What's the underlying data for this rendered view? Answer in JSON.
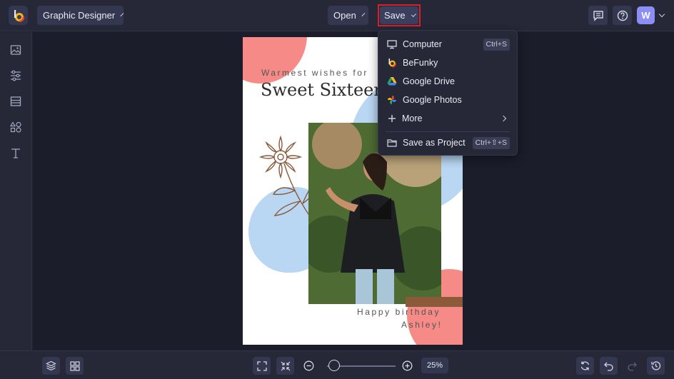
{
  "topbar": {
    "project_type": "Graphic Designer",
    "open_label": "Open",
    "save_label": "Save",
    "avatar_initial": "W"
  },
  "icons": {
    "logo": "befunky-logo-icon",
    "chat": "feedback-icon",
    "help": "help-icon",
    "sidebar": [
      "image-icon",
      "adjust-icon",
      "layout-icon",
      "elements-icon",
      "text-icon"
    ]
  },
  "save_menu": {
    "items": [
      {
        "label": "Computer",
        "shortcut": "Ctrl+S",
        "icon": "monitor-icon"
      },
      {
        "label": "BeFunky",
        "shortcut": "",
        "icon": "befunky-icon"
      },
      {
        "label": "Google Drive",
        "shortcut": "",
        "icon": "google-drive-icon"
      },
      {
        "label": "Google Photos",
        "shortcut": "",
        "icon": "google-photos-icon"
      },
      {
        "label": "More",
        "shortcut": "",
        "icon": "plus-icon"
      }
    ],
    "project": {
      "label": "Save as Project",
      "shortcut": "Ctrl+⇧+S",
      "icon": "folder-icon"
    }
  },
  "card": {
    "line1": "Warmest wishes for",
    "title": "Sweet Sixteen!",
    "line2": "Happy birthday",
    "line3": "Ashley!"
  },
  "bottombar": {
    "zoom_percent": "25%",
    "zoom_level": 0.1
  },
  "colors": {
    "accent_outline": "#d9202a",
    "avatar": "#8d8ef5",
    "card_pink": "#f58a87",
    "card_blue": "#b9d6f2"
  }
}
